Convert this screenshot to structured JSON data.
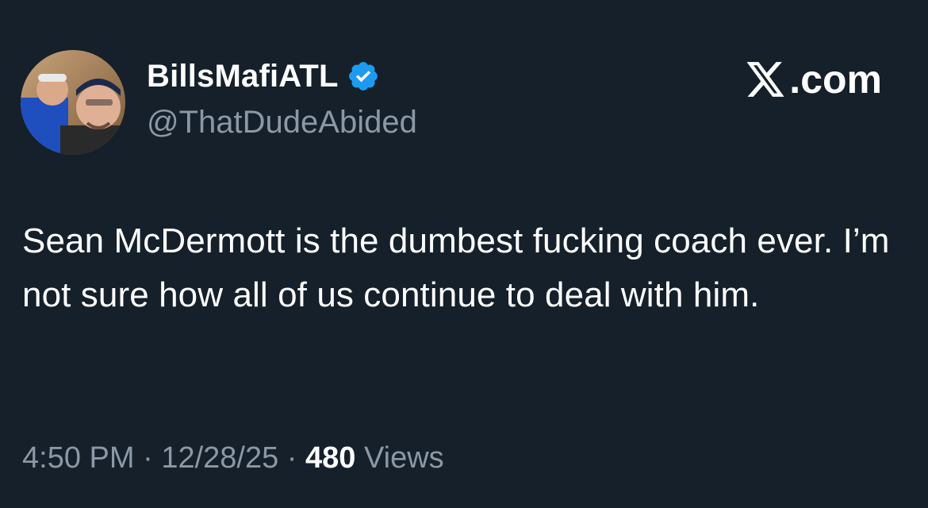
{
  "author": {
    "display_name": "BillsMafiATL",
    "handle": "@ThatDudeAbided",
    "verified": true,
    "verified_color": "#1d9bf0",
    "avatar_icon": "profile-photo"
  },
  "brand": {
    "icon": "x-logo-icon",
    "label": ".com"
  },
  "tweet": {
    "text": "Sean McDermott is the dumbest fucking coach ever. I’m not sure how all of us continue to deal with him."
  },
  "meta": {
    "time": "4:50 PM",
    "separator": "·",
    "date": "12/28/25",
    "views_count": "480",
    "views_label": "Views"
  },
  "colors": {
    "background": "#15202b",
    "text_primary": "#ffffff",
    "text_secondary": "#8b98a5"
  }
}
